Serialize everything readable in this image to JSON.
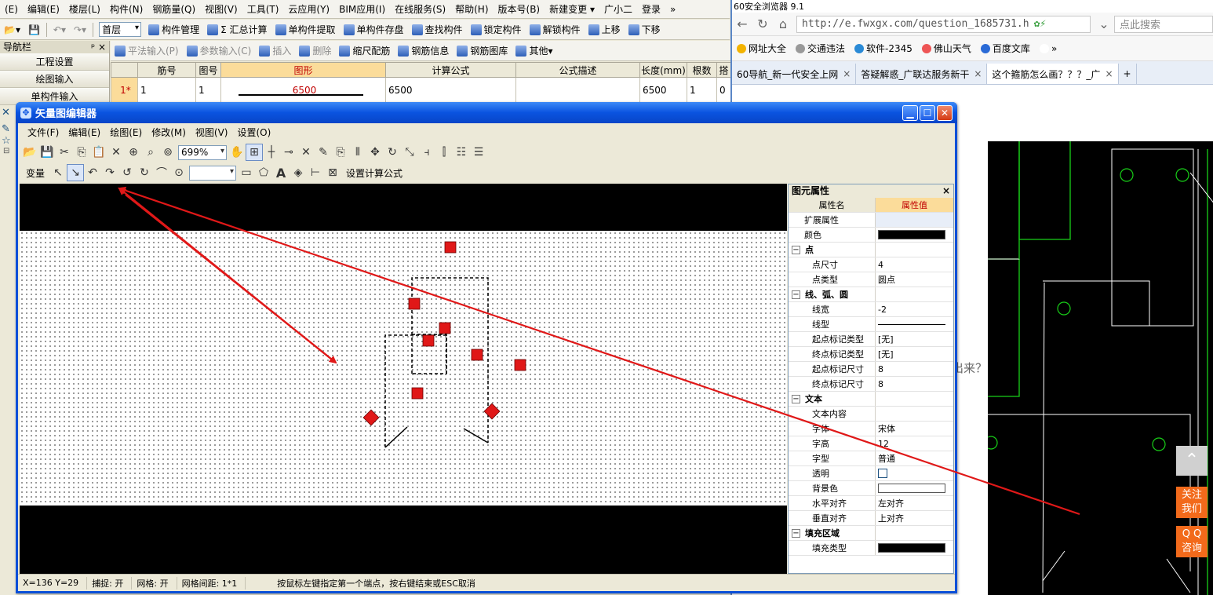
{
  "main_menu": [
    "(E)",
    "编辑(E)",
    "楼层(L)",
    "构件(N)",
    "钢筋量(Q)",
    "视图(V)",
    "工具(T)",
    "云应用(Y)",
    "BIM应用(I)",
    "在线服务(S)",
    "帮助(H)",
    "版本号(B)",
    "新建变更 ▾",
    "广小二",
    "登录",
    "»"
  ],
  "main_toolbar": {
    "floor": "首层",
    "buttons": [
      "构件管理",
      "Σ 汇总计算",
      "单构件提取",
      "单构件存盘",
      "查找构件",
      "锁定构件",
      "解锁构件",
      "上移",
      "下移"
    ]
  },
  "nav_panel": {
    "title": "导航栏",
    "pin": "ᵖ",
    "close": "×",
    "items": [
      "工程设置",
      "绘图输入",
      "单构件输入"
    ]
  },
  "grid_toolbar": [
    "平法输入(P)",
    "参数输入(C)",
    "插入",
    "删除",
    "缩尺配筋",
    "钢筋信息",
    "钢筋图库",
    "其他▾"
  ],
  "rebar_table": {
    "headers": [
      "",
      "筋号",
      "图号",
      "图形",
      "计算公式",
      "公式描述",
      "长度(mm)",
      "根数",
      "搭"
    ],
    "row": [
      "1*",
      "1",
      "1",
      "6500",
      "6500",
      "",
      "6500",
      "1",
      "0"
    ]
  },
  "browser": {
    "title_text": "60安全浏览器 9.1",
    "url": "http://e.fwxgx.com/question_1685731.h",
    "search_placeholder": "点此搜索",
    "favorites": [
      "网址大全",
      "交通违法",
      "软件-2345",
      "佛山天气",
      "百度文库",
      "»"
    ],
    "tabs": [
      "60导航_新一代安全上网",
      "答疑解惑_广联达服务新干",
      "这个箍筋怎么画？？？_广"
    ],
    "page_text": "出来？",
    "side_top": "⌃",
    "side_follow": [
      "关注",
      "我们"
    ],
    "side_qq": [
      "Q Q",
      "咨询"
    ]
  },
  "dialog": {
    "title": "矢量图编辑器",
    "menu": [
      "文件(F)",
      "编辑(E)",
      "绘图(E)",
      "修改(M)",
      "视图(V)",
      "设置(O)"
    ],
    "zoom": "699%",
    "var_label": "变量",
    "formula_button": "设置计算公式",
    "properties": {
      "title": "图元属性",
      "close": "×",
      "header_name": "属性名",
      "header_value": "属性值",
      "rows": [
        {
          "kind": "plain",
          "name": "扩展属性",
          "value": ""
        },
        {
          "kind": "plain",
          "name": "颜色",
          "value": ""
        },
        {
          "kind": "group",
          "name": "点",
          "value": ""
        },
        {
          "kind": "item",
          "name": "点尺寸",
          "value": "4"
        },
        {
          "kind": "item",
          "name": "点类型",
          "value": "圆点"
        },
        {
          "kind": "group",
          "name": "线、弧、圆",
          "value": ""
        },
        {
          "kind": "item",
          "name": "线宽",
          "value": "-2"
        },
        {
          "kind": "item",
          "name": "线型",
          "value": ""
        },
        {
          "kind": "item",
          "name": "起点标记类型",
          "value": "[无]"
        },
        {
          "kind": "item",
          "name": "终点标记类型",
          "value": "[无]"
        },
        {
          "kind": "item",
          "name": "起点标记尺寸",
          "value": "8"
        },
        {
          "kind": "item",
          "name": "终点标记尺寸",
          "value": "8"
        },
        {
          "kind": "group",
          "name": "文本",
          "value": ""
        },
        {
          "kind": "item",
          "name": "文本内容",
          "value": ""
        },
        {
          "kind": "item",
          "name": "字体",
          "value": "宋体"
        },
        {
          "kind": "item",
          "name": "字高",
          "value": "12"
        },
        {
          "kind": "item",
          "name": "字型",
          "value": "普通"
        },
        {
          "kind": "item",
          "name": "透明",
          "value": ""
        },
        {
          "kind": "item",
          "name": "背景色",
          "value": ""
        },
        {
          "kind": "item",
          "name": "水平对齐",
          "value": "左对齐"
        },
        {
          "kind": "item",
          "name": "垂直对齐",
          "value": "上对齐"
        },
        {
          "kind": "group",
          "name": "填充区域",
          "value": ""
        },
        {
          "kind": "item",
          "name": "填充类型",
          "value": ""
        }
      ]
    },
    "status": {
      "coords": "X=136 Y=29",
      "snap": "捕捉: 开",
      "grid": "网格: 开",
      "grid_spacing": "网格间距: 1*1",
      "hint": "按鼠标左键指定第一个端点，按右键结束或ESC取消"
    }
  },
  "colors": {
    "annotation_arrow": "#e01818",
    "marker": "#e01818",
    "title_bar": "#0a53e0",
    "highlight": "#fbdc9a"
  }
}
